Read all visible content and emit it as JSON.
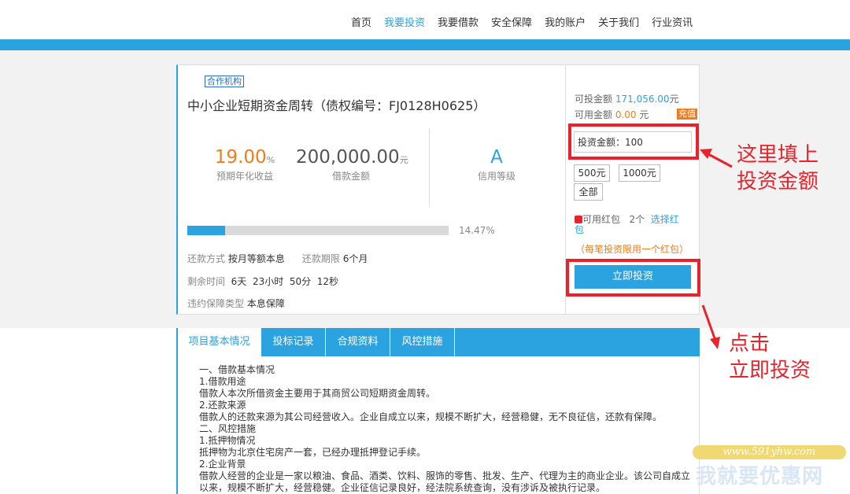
{
  "nav": [
    "首页",
    "我要投资",
    "我要借款",
    "安全保障",
    "我的账户",
    "关于我们",
    "行业资讯"
  ],
  "loan": {
    "tag": "合作机构",
    "title": "中小企业短期资金周转（债权编号：FJ0128H0625）",
    "rate": "19.00",
    "rate_unit": "%",
    "rate_label": "预期年化收益",
    "amount": "200,000.00",
    "amount_unit": "元",
    "amount_label": "借款金额",
    "grade": "A",
    "grade_label": "信用等级",
    "progress_percent": 14.47,
    "progress_text": "14.47%",
    "repay_label": "还款方式",
    "repay_value": "按月等额本息",
    "term_label": "还款期限",
    "term_value": "6个月",
    "remain_label": "剩余时间",
    "remain_days": "6天",
    "remain_hours": "23小时",
    "remain_mins": "50分",
    "remain_secs": "12秒",
    "guarantee_label": "违约保障类型",
    "guarantee_value": "本息保障"
  },
  "invest": {
    "available_label": "可投金额",
    "available_amount": "171,056.00",
    "available_unit": "元",
    "balance_label": "可用金额",
    "balance_amount": "0.00",
    "balance_unit": "元",
    "recharge": "充值",
    "input_value": "投资金额：100",
    "quick_1": "500元",
    "quick_2": "1000元",
    "quick_all": "全部",
    "hongbao_label": "可用红包",
    "hongbao_count": "2个",
    "hongbao_link": "选择红包",
    "hongbao_note": "（每笔投资限用一个红包）",
    "submit": "立即投资"
  },
  "tabs": [
    "项目基本情况",
    "投标记录",
    "合规资料",
    "风控措施"
  ],
  "content_lines": [
    "一、借款基本情况",
    "1.借款用途",
    "借款人本次所借资金主要用于其商贸公司短期资金周转。",
    "2.还款来源",
    "借款人的还款来源为其公司经营收入。企业自成立以来，规模不断扩大，经营稳健，无不良征信，还款有保障。",
    "二、风控措施",
    "1.抵押物情况",
    "抵押物为北京住宅房产一套，已经办理抵押登记手续。",
    "2.企业背景",
    "借款人经营的企业是一家以粮油、食品、酒类、饮料、服饰的零售、批发、生产、代理为主的商业企业。该公司自成立",
    "以来，规模不断扩大，经营稳健。企业征信记录良好，经法院系统查询，没有涉诉及被执行记录。"
  ],
  "annotations": {
    "fill_line1": "这里填上",
    "fill_line2": "投资金额",
    "click_line1": "点击",
    "click_line2": "立即投资"
  },
  "watermark": {
    "url": "www.591yhw.com",
    "name": "我就要优惠网"
  },
  "colors": {
    "accent": "#2aa3e0",
    "orange": "#f07c1c",
    "annotation_red": "#e8232b"
  }
}
